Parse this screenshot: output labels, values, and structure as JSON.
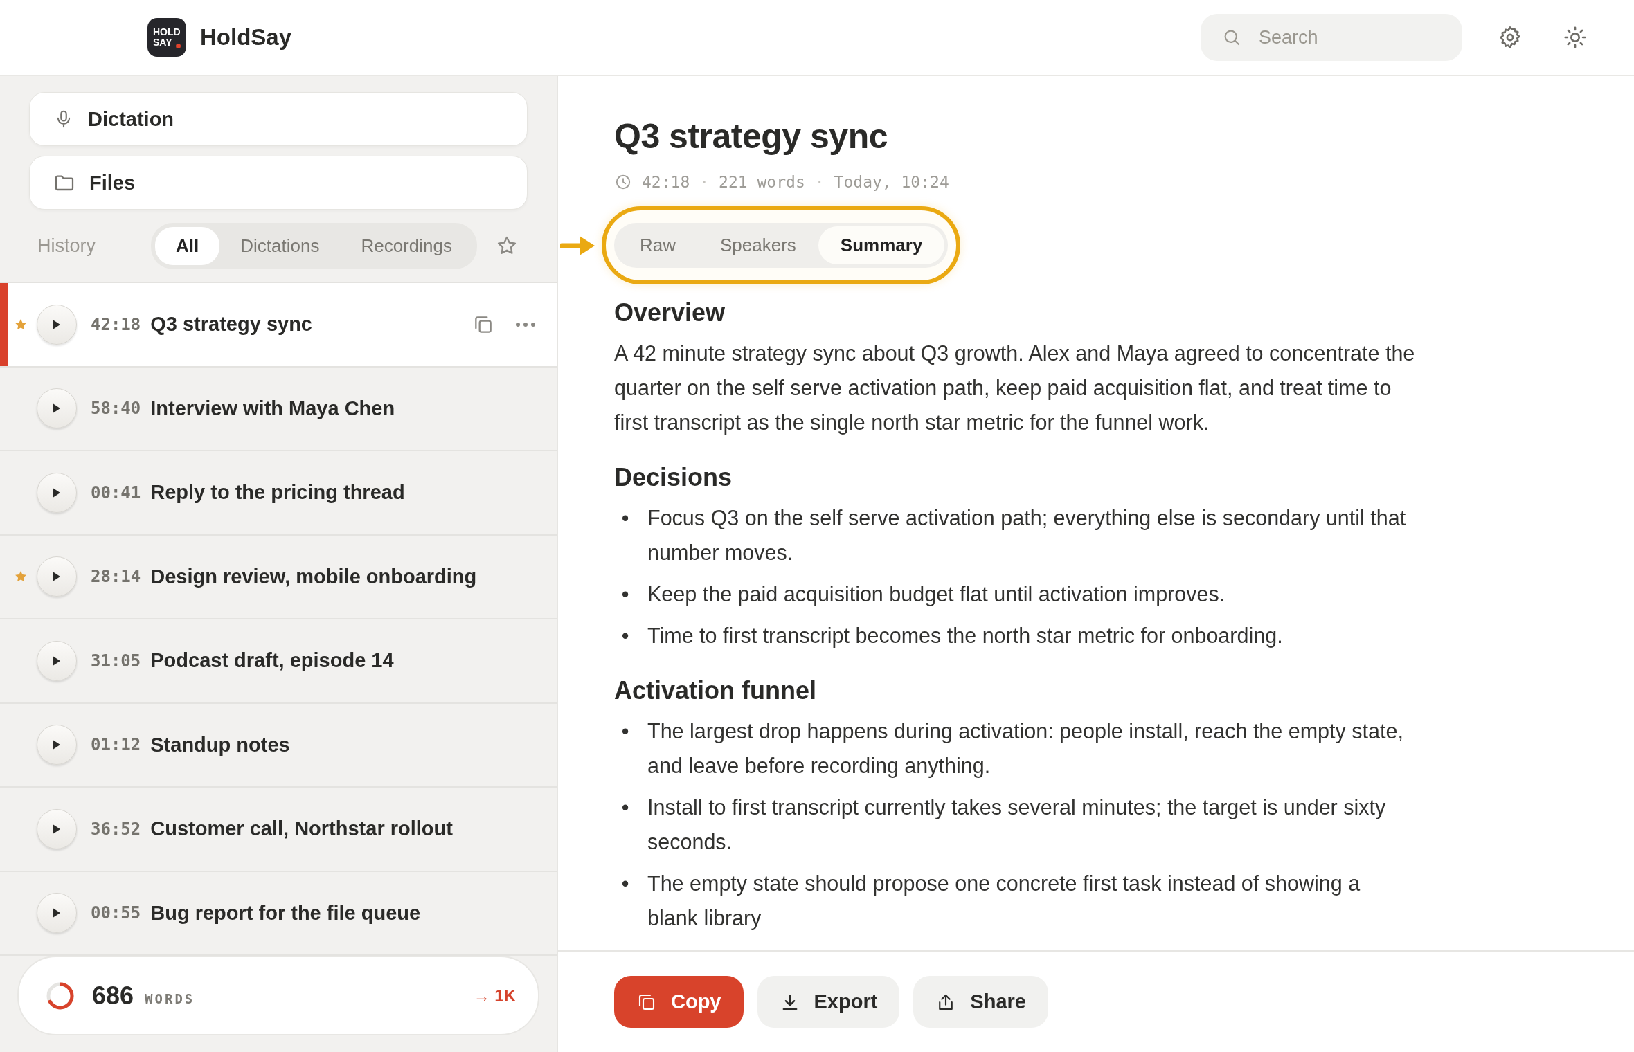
{
  "app": {
    "logo_top": "HOLD",
    "logo_bottom": "SAY",
    "name": "HoldSay"
  },
  "search": {
    "placeholder": "Search"
  },
  "nav": [
    {
      "label": "Dictation",
      "kind": "mic"
    },
    {
      "label": "Files",
      "kind": "folder"
    }
  ],
  "history": {
    "label": "History",
    "filters": [
      {
        "label": "All",
        "selected": true
      },
      {
        "label": "Dictations",
        "selected": false
      },
      {
        "label": "Recordings",
        "selected": false
      }
    ],
    "starred_only": false
  },
  "recordings": [
    {
      "duration": "42:18",
      "title": "Q3 strategy sync",
      "starred": true,
      "selected": true
    },
    {
      "duration": "58:40",
      "title": "Interview with Maya Chen",
      "starred": false,
      "selected": false
    },
    {
      "duration": "00:41",
      "title": "Reply to the pricing thread",
      "starred": false,
      "selected": false
    },
    {
      "duration": "28:14",
      "title": "Design review, mobile onboarding",
      "starred": true,
      "selected": false
    },
    {
      "duration": "31:05",
      "title": "Podcast draft, episode 14",
      "starred": false,
      "selected": false
    },
    {
      "duration": "01:12",
      "title": "Standup notes",
      "starred": false,
      "selected": false
    },
    {
      "duration": "36:52",
      "title": "Customer call, Northstar rollout",
      "starred": false,
      "selected": false
    },
    {
      "duration": "00:55",
      "title": "Bug report for the file queue",
      "starred": false,
      "selected": false
    }
  ],
  "word_goal": {
    "count": "686",
    "unit": "WORDS",
    "goal": "→ 1K",
    "level": 0.686
  },
  "document": {
    "title": "Q3 strategy sync",
    "meta": [
      "42:18",
      "221 words",
      "Today, 10:24"
    ],
    "meta_separator": "·",
    "bullet": "•",
    "views": [
      {
        "label": "Raw",
        "selected": false
      },
      {
        "label": "Speakers",
        "selected": false
      },
      {
        "label": "Summary",
        "selected": true
      }
    ],
    "sections": [
      {
        "heading": "Overview",
        "kind": "paragraph",
        "text": "A 42 minute strategy sync about Q3 growth. Alex and Maya agreed to concentrate the quarter on the self serve activation path, keep paid acquisition flat, and treat time to first transcript as the single north star metric for the funnel work."
      },
      {
        "heading": "Decisions",
        "kind": "bullets",
        "items": [
          "Focus Q3 on the self serve activation path; everything else is secondary until that number moves.",
          "Keep the paid acquisition budget flat until activation improves.",
          "Time to first transcript becomes the north star metric for onboarding."
        ]
      },
      {
        "heading": "Activation funnel",
        "kind": "bullets",
        "items": [
          "The largest drop happens during activation: people install, reach the empty state, and leave before recording anything.",
          "Install to first transcript currently takes several minutes; the target is under sixty seconds.",
          "The empty state should propose one concrete first task instead of showing a blank library"
        ]
      }
    ]
  },
  "actions": [
    {
      "label": "Copy",
      "kind": "copy",
      "primary": true
    },
    {
      "label": "Export",
      "kind": "export",
      "primary": false
    },
    {
      "label": "Share",
      "kind": "share",
      "primary": false
    }
  ]
}
